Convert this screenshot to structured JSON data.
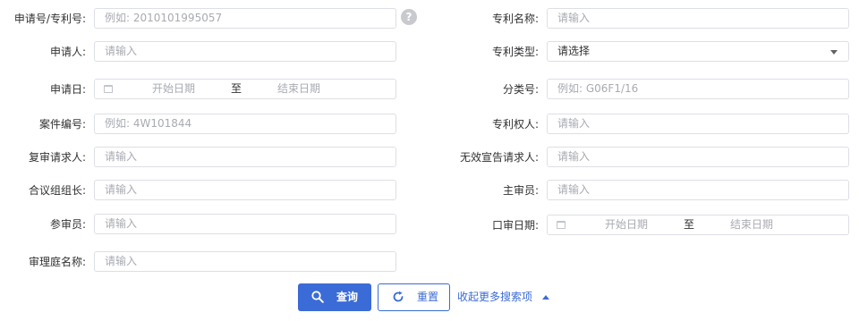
{
  "left": {
    "app_no": {
      "label": "申请号/专利号:",
      "placeholder": "例如: 2010101995057"
    },
    "applicant": {
      "label": "申请人:",
      "placeholder": "请输入"
    },
    "apply_date": {
      "label": "申请日:",
      "start": "开始日期",
      "sep": "至",
      "end": "结束日期"
    },
    "case_no": {
      "label": "案件编号:",
      "placeholder": "例如: 4W101844"
    },
    "reexam_requester": {
      "label": "复审请求人:",
      "placeholder": "请输入"
    },
    "panel_leader": {
      "label": "合议组组长:",
      "placeholder": "请输入"
    },
    "assoc_examiner": {
      "label": "参审员:",
      "placeholder": "请输入"
    },
    "court_name": {
      "label": "审理庭名称:",
      "placeholder": "请输入"
    }
  },
  "right": {
    "patent_name": {
      "label": "专利名称:",
      "placeholder": "请输入"
    },
    "patent_type": {
      "label": "专利类型:",
      "value": "请选择"
    },
    "class_no": {
      "label": "分类号:",
      "placeholder": "例如: G06F1/16"
    },
    "patentee": {
      "label": "专利权人:",
      "placeholder": "请输入"
    },
    "invalid_requester": {
      "label": "无效宣告请求人:",
      "placeholder": "请输入"
    },
    "chief_examiner": {
      "label": "主审员:",
      "placeholder": "请输入"
    },
    "oral_date": {
      "label": "口审日期:",
      "start": "开始日期",
      "sep": "至",
      "end": "结束日期"
    }
  },
  "help_icon": "?",
  "actions": {
    "search": "查询",
    "reset": "重置",
    "collapse": "收起更多搜索项"
  },
  "colors": {
    "primary": "#3b6bd6",
    "border": "#dcdfe6",
    "placeholder": "#a8abb2"
  }
}
